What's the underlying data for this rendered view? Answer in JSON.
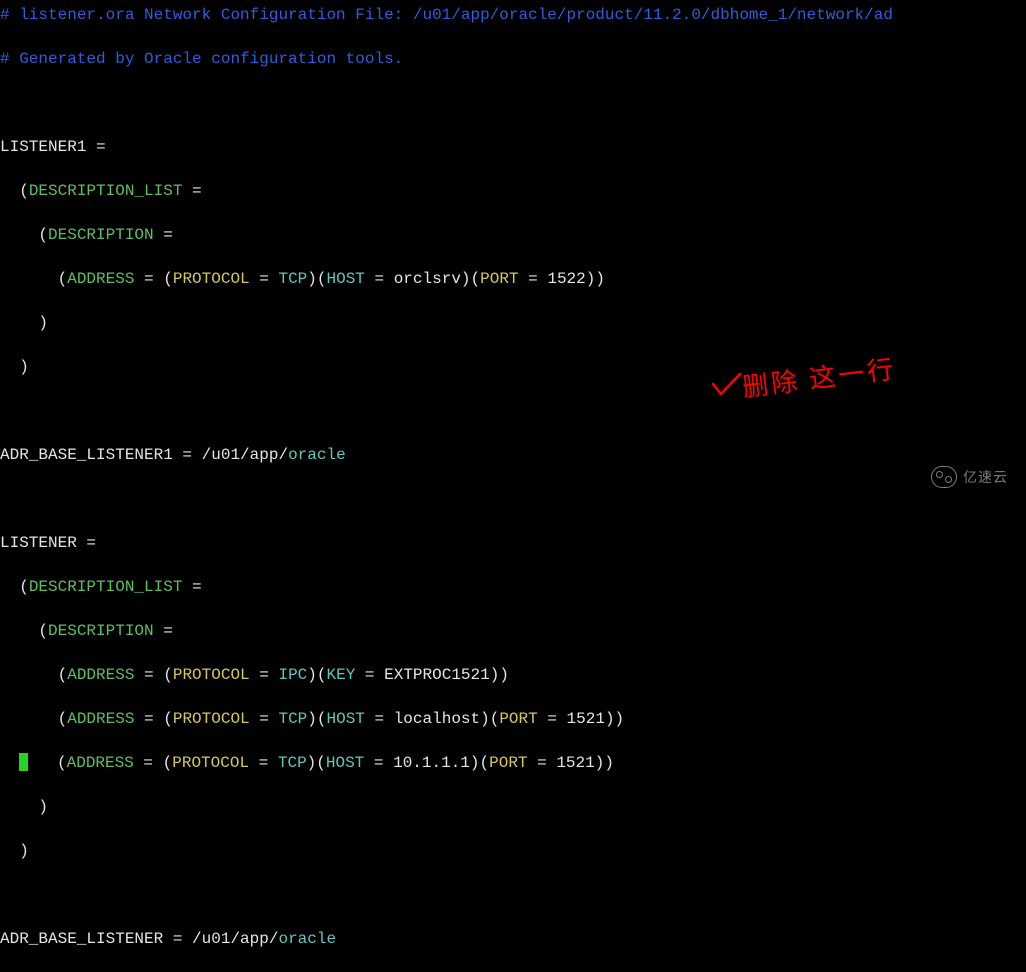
{
  "comments": {
    "line1": "# listener.ora Network Configuration File: /u01/app/oracle/product/11.2.0/dbhome_1/network/ad",
    "line2": "# Generated by Oracle configuration tools."
  },
  "keywords": {
    "description_list": "DESCRIPTION_LIST",
    "description": "DESCRIPTION",
    "address": "ADDRESS",
    "protocol": "PROTOCOL",
    "host": "HOST",
    "port": "PORT",
    "key": "KEY",
    "oracle": "oracle"
  },
  "listener1": {
    "name": "LISTENER1",
    "protocol": "TCP",
    "host": "orclsrv",
    "port": "1522",
    "adr_base_prefix": "ADR_BASE_LISTENER1",
    "adr_base_path": "/u01/app/"
  },
  "listener": {
    "name": "LISTENER",
    "addr1": {
      "protocol": "IPC",
      "key": "EXTPROC1521"
    },
    "addr2": {
      "protocol": "TCP",
      "host": "localhost",
      "port": "1521"
    },
    "addr3": {
      "protocol": "TCP",
      "host": "10.1.1.1",
      "port": "1521"
    },
    "adr_base_prefix": "ADR_BASE_LISTENER",
    "adr_base_path": "/u01/app/"
  },
  "annotation": {
    "text": "删除 这一行"
  },
  "watermark": "亿速云"
}
